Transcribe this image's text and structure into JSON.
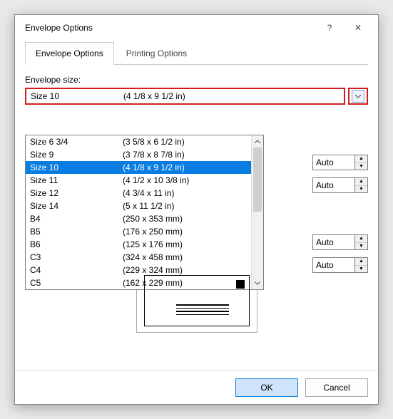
{
  "title": "Envelope Options",
  "titlebar": {
    "help_icon": "?",
    "close_icon": "✕"
  },
  "tabs": {
    "options_label": "Envelope Options",
    "printing_label": "Printing Options"
  },
  "envelope_size": {
    "label": "Envelope size:",
    "selected_name": "Size 10",
    "selected_dims": "(4 1/8 x 9 1/2 in)",
    "options": [
      {
        "name": "Size 6 3/4",
        "dims": "(3 5/8 x 6 1/2 in)"
      },
      {
        "name": "Size 9",
        "dims": "(3 7/8 x 8 7/8 in)"
      },
      {
        "name": "Size 10",
        "dims": "(4 1/8 x 9 1/2 in)"
      },
      {
        "name": "Size 11",
        "dims": "(4 1/2 x 10 3/8 in)"
      },
      {
        "name": "Size 12",
        "dims": "(4 3/4 x 11 in)"
      },
      {
        "name": "Size 14",
        "dims": "(5 x 11 1/2 in)"
      },
      {
        "name": "B4",
        "dims": "(250 x 353 mm)"
      },
      {
        "name": "B5",
        "dims": "(176 x 250 mm)"
      },
      {
        "name": "B6",
        "dims": "(125 x 176 mm)"
      },
      {
        "name": "C3",
        "dims": "(324 x 458 mm)"
      },
      {
        "name": "C4",
        "dims": "(229 x 324 mm)"
      },
      {
        "name": "C5",
        "dims": "(162 x 229 mm)"
      }
    ]
  },
  "spin_values": {
    "auto1": "Auto",
    "auto2": "Auto",
    "auto3": "Auto",
    "auto4": "Auto"
  },
  "buttons": {
    "ok": "OK",
    "cancel": "Cancel"
  }
}
